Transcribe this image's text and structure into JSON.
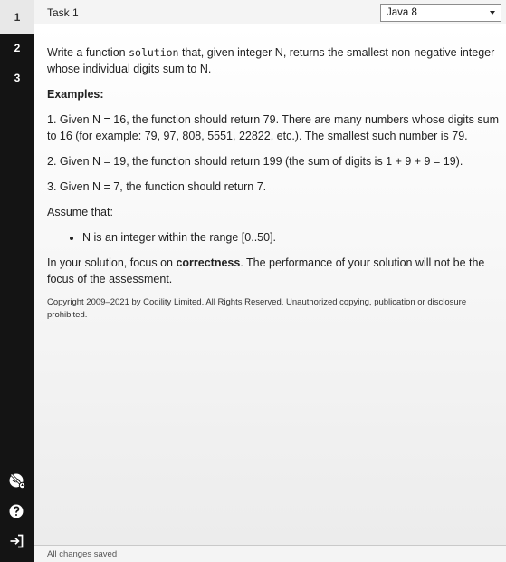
{
  "sidebar": {
    "tasks": [
      "1",
      "2",
      "3"
    ],
    "icons": [
      "hide-eye-icon",
      "help-icon",
      "logout-icon"
    ]
  },
  "header": {
    "task_title": "Task 1",
    "language": "Java 8"
  },
  "task": {
    "intro_before": "Write a function ",
    "intro_code": "solution",
    "intro_after": " that, given integer N, returns the smallest non-negative integer whose individual digits sum to N.",
    "examples_heading": "Examples:",
    "example1": "1. Given N = 16, the function should return 79. There are many numbers whose digits sum to 16 (for example: 79, 97, 808, 5551, 22822, etc.). The smallest such number is 79.",
    "example2": "2. Given N = 19, the function should return 199 (the sum of digits is 1 + 9 + 9 = 19).",
    "example3": "3. Given N = 7, the function should return 7.",
    "assume": "Assume that:",
    "assumptions": [
      "N is an integer within the range [0..50]."
    ],
    "focus_before": "In your solution, focus on ",
    "focus_bold": "correctness",
    "focus_after": ". The performance of your solution will not be the focus of the assessment.",
    "copyright": "Copyright 2009–2021 by Codility Limited. All Rights Reserved. Unauthorized copying, publication or disclosure prohibited."
  },
  "footer": {
    "status": "All changes saved"
  },
  "colors": {
    "sidebar": "#141414",
    "active_tab": "#e8e8e8"
  }
}
